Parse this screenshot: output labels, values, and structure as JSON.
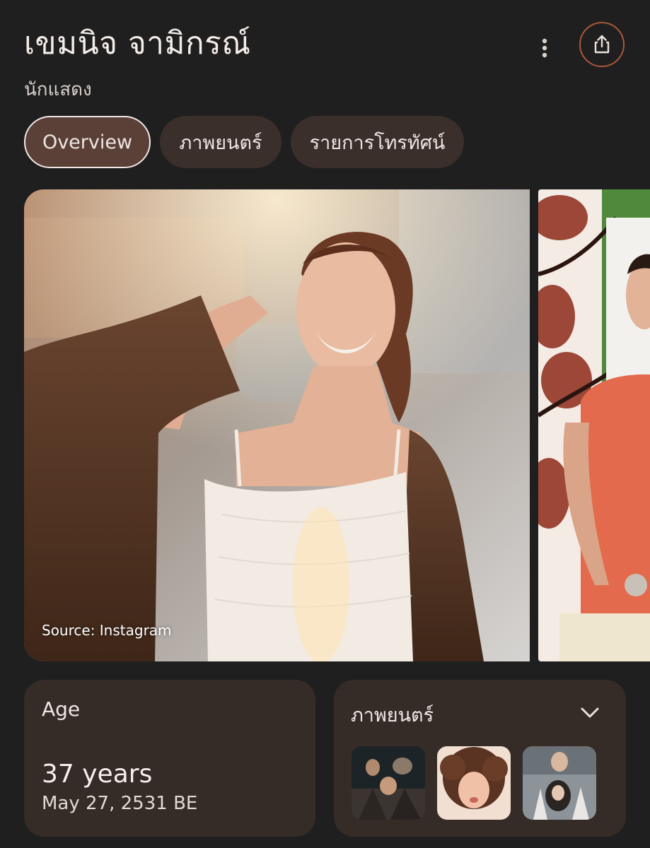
{
  "header": {
    "title": "เขมนิจ จามิกรณ์",
    "subtitle": "นักแสดง"
  },
  "actions": {
    "more_icon": "more-vertical-icon",
    "share_icon": "share-icon"
  },
  "tabs": [
    {
      "label": "Overview",
      "active": true
    },
    {
      "label": "ภาพยนตร์",
      "active": false
    },
    {
      "label": "รายการโทรทัศน์",
      "active": false
    }
  ],
  "gallery": {
    "source_label": "Source: Instagram"
  },
  "age_card": {
    "label": "Age",
    "value": "37 years",
    "date": "May 27, 2531 BE"
  },
  "films_card": {
    "label": "ภาพยนตร์",
    "expand_icon": "chevron-down-icon"
  },
  "colors": {
    "background": "#1f1f1f",
    "card": "#352b27",
    "chip": "#3a2f2b",
    "chip_active": "#5b4038",
    "accent_ring": "#a9593b"
  }
}
